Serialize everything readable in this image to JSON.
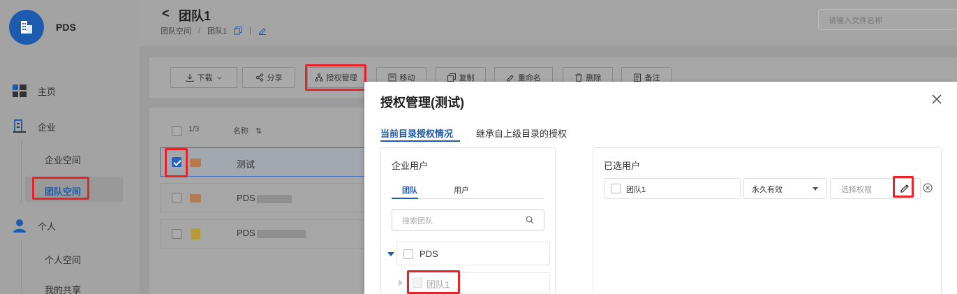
{
  "sidebar": {
    "brand": "PDS",
    "nav": {
      "home": "主页",
      "enterprise": "企业",
      "enterprise_space": "企业空间",
      "team_space": "团队空间",
      "personal": "个人",
      "personal_space": "个人空间",
      "my_shares": "我的共享"
    }
  },
  "header": {
    "back_glyph": "<",
    "title": "团队1",
    "breadcrumb_root": "团队空间",
    "breadcrumb_sep": "/",
    "breadcrumb_current": "团队1",
    "search_placeholder": "请输入文件名称"
  },
  "toolbar": {
    "download": "下载",
    "share": "分享",
    "permissions": "授权管理",
    "move": "移动",
    "copy": "复制",
    "rename": "重命名",
    "delete": "删除",
    "note": "备注"
  },
  "list": {
    "selected_count": "1/3",
    "name_header": "名称",
    "sort_glyph": "⇅",
    "rows": [
      {
        "name": "测试",
        "checked": true,
        "type": "folder"
      },
      {
        "name": "PDS",
        "checked": false,
        "type": "folder"
      },
      {
        "name": "PDS",
        "checked": false,
        "type": "file"
      }
    ]
  },
  "modal": {
    "title": "授权管理(测试)",
    "tabs": [
      "当前目录授权情况",
      "继承自上级目录的授权"
    ],
    "left_pane": {
      "title": "企业用户",
      "subtabs": [
        "团队",
        "用户"
      ],
      "search_placeholder": "搜索团队",
      "tree": [
        {
          "label": "PDS"
        },
        {
          "label": "团队1"
        }
      ]
    },
    "right_pane": {
      "title": "已选用户",
      "selected_user": "团队1",
      "validity": "永久有效",
      "permission_placeholder": "选择权限"
    }
  },
  "colors": {
    "accent": "#1d5bb0",
    "highlight": "#e8232a"
  }
}
